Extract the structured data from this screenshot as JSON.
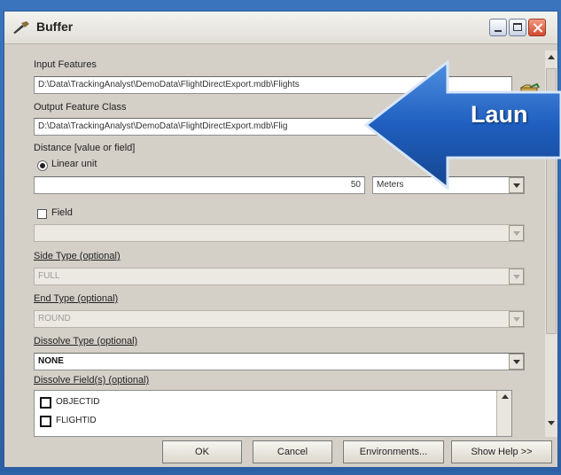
{
  "window": {
    "title": "Buffer"
  },
  "form": {
    "input_features": {
      "label": "Input Features",
      "value": "D:\\Data\\TrackingAnalyst\\DemoData\\FlightDirectExport.mdb\\Flights"
    },
    "output_feature_class": {
      "label": "Output Feature Class",
      "value": "D:\\Data\\TrackingAnalyst\\DemoData\\FlightDirectExport.mdb\\Flig"
    },
    "distance": {
      "label": "Distance [value or field]",
      "linear_unit_label": "Linear unit",
      "value": "50",
      "unit": "Meters",
      "field_label": "Field",
      "field_value": ""
    },
    "side_type": {
      "label": "Side Type (optional)",
      "value": "FULL"
    },
    "end_type": {
      "label": "End Type (optional)",
      "value": "ROUND"
    },
    "dissolve_type": {
      "label": "Dissolve Type (optional)",
      "value": "NONE"
    },
    "dissolve_fields": {
      "label": "Dissolve Field(s) (optional)",
      "items": [
        "OBJECTID",
        "FLIGHTID"
      ]
    }
  },
  "buttons": {
    "ok": "OK",
    "cancel": "Cancel",
    "environments": "Environments...",
    "show_help": "Show Help >>"
  },
  "callout": {
    "text": "Laun",
    "color": "#1f5fbf"
  },
  "icons": {
    "title": "buffer-tool-icon",
    "browse": "open-folder-icon"
  }
}
